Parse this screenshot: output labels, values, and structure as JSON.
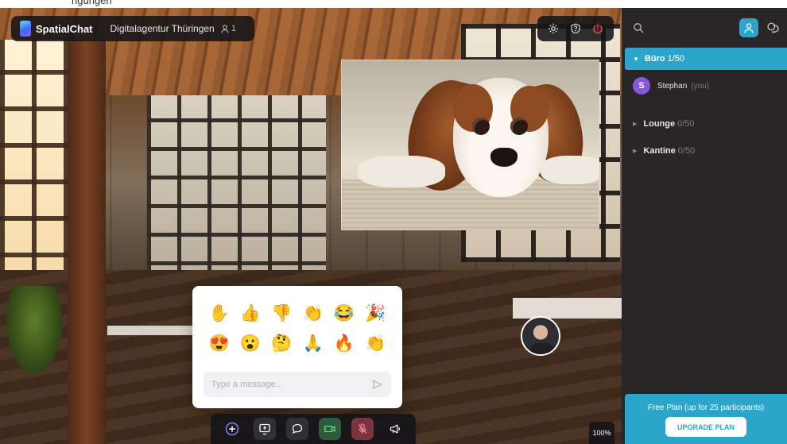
{
  "caption": "ngungen",
  "app": {
    "name": "SpatialChat"
  },
  "room": {
    "name": "Digitalagentur Thüringen",
    "participants": "1"
  },
  "emoji": {
    "row1": [
      "✋",
      "👍",
      "👎",
      "👏",
      "😂",
      "🎉"
    ],
    "row2": [
      "😍",
      "😮",
      "🤔",
      "🙏",
      "🔥",
      "👏"
    ]
  },
  "chat": {
    "placeholder": "Type a message..."
  },
  "zoom": "100%",
  "sidebar": {
    "active_room": {
      "name": "Büro",
      "count": "1/50"
    },
    "member": {
      "initial": "S",
      "name": "Stephan",
      "tag": "(you)"
    },
    "rooms": [
      {
        "name": "Lounge",
        "count": "0/50"
      },
      {
        "name": "Kantine",
        "count": "0/50"
      }
    ],
    "plan": {
      "text": "Free Plan (up for 25 participants)",
      "button": "UPGRADE PLAN"
    }
  },
  "colors": {
    "accent": "#2ba5c9",
    "avatar": "#8a56d9",
    "cam_on": "#2c5c3b",
    "mic_off": "#7b3340"
  },
  "icons": [
    "logo-icon",
    "user-icon",
    "settings-icon",
    "help-icon",
    "power-icon",
    "search-icon",
    "people-icon",
    "chat-bubbles-icon",
    "add-icon",
    "screen-share-icon",
    "chat-icon",
    "camera-icon",
    "mic-off-icon",
    "megaphone-icon",
    "send-icon"
  ]
}
